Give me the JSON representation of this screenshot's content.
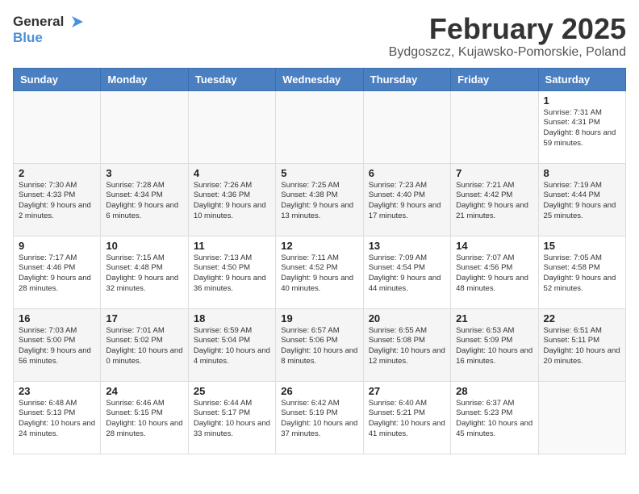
{
  "header": {
    "logo_general": "General",
    "logo_blue": "Blue",
    "title": "February 2025",
    "subtitle": "Bydgoszcz, Kujawsko-Pomorskie, Poland"
  },
  "columns": [
    "Sunday",
    "Monday",
    "Tuesday",
    "Wednesday",
    "Thursday",
    "Friday",
    "Saturday"
  ],
  "weeks": [
    [
      {
        "day": "",
        "text": ""
      },
      {
        "day": "",
        "text": ""
      },
      {
        "day": "",
        "text": ""
      },
      {
        "day": "",
        "text": ""
      },
      {
        "day": "",
        "text": ""
      },
      {
        "day": "",
        "text": ""
      },
      {
        "day": "1",
        "text": "Sunrise: 7:31 AM\nSunset: 4:31 PM\nDaylight: 8 hours and 59 minutes."
      }
    ],
    [
      {
        "day": "2",
        "text": "Sunrise: 7:30 AM\nSunset: 4:33 PM\nDaylight: 9 hours and 2 minutes."
      },
      {
        "day": "3",
        "text": "Sunrise: 7:28 AM\nSunset: 4:34 PM\nDaylight: 9 hours and 6 minutes."
      },
      {
        "day": "4",
        "text": "Sunrise: 7:26 AM\nSunset: 4:36 PM\nDaylight: 9 hours and 10 minutes."
      },
      {
        "day": "5",
        "text": "Sunrise: 7:25 AM\nSunset: 4:38 PM\nDaylight: 9 hours and 13 minutes."
      },
      {
        "day": "6",
        "text": "Sunrise: 7:23 AM\nSunset: 4:40 PM\nDaylight: 9 hours and 17 minutes."
      },
      {
        "day": "7",
        "text": "Sunrise: 7:21 AM\nSunset: 4:42 PM\nDaylight: 9 hours and 21 minutes."
      },
      {
        "day": "8",
        "text": "Sunrise: 7:19 AM\nSunset: 4:44 PM\nDaylight: 9 hours and 25 minutes."
      }
    ],
    [
      {
        "day": "9",
        "text": "Sunrise: 7:17 AM\nSunset: 4:46 PM\nDaylight: 9 hours and 28 minutes."
      },
      {
        "day": "10",
        "text": "Sunrise: 7:15 AM\nSunset: 4:48 PM\nDaylight: 9 hours and 32 minutes."
      },
      {
        "day": "11",
        "text": "Sunrise: 7:13 AM\nSunset: 4:50 PM\nDaylight: 9 hours and 36 minutes."
      },
      {
        "day": "12",
        "text": "Sunrise: 7:11 AM\nSunset: 4:52 PM\nDaylight: 9 hours and 40 minutes."
      },
      {
        "day": "13",
        "text": "Sunrise: 7:09 AM\nSunset: 4:54 PM\nDaylight: 9 hours and 44 minutes."
      },
      {
        "day": "14",
        "text": "Sunrise: 7:07 AM\nSunset: 4:56 PM\nDaylight: 9 hours and 48 minutes."
      },
      {
        "day": "15",
        "text": "Sunrise: 7:05 AM\nSunset: 4:58 PM\nDaylight: 9 hours and 52 minutes."
      }
    ],
    [
      {
        "day": "16",
        "text": "Sunrise: 7:03 AM\nSunset: 5:00 PM\nDaylight: 9 hours and 56 minutes."
      },
      {
        "day": "17",
        "text": "Sunrise: 7:01 AM\nSunset: 5:02 PM\nDaylight: 10 hours and 0 minutes."
      },
      {
        "day": "18",
        "text": "Sunrise: 6:59 AM\nSunset: 5:04 PM\nDaylight: 10 hours and 4 minutes."
      },
      {
        "day": "19",
        "text": "Sunrise: 6:57 AM\nSunset: 5:06 PM\nDaylight: 10 hours and 8 minutes."
      },
      {
        "day": "20",
        "text": "Sunrise: 6:55 AM\nSunset: 5:08 PM\nDaylight: 10 hours and 12 minutes."
      },
      {
        "day": "21",
        "text": "Sunrise: 6:53 AM\nSunset: 5:09 PM\nDaylight: 10 hours and 16 minutes."
      },
      {
        "day": "22",
        "text": "Sunrise: 6:51 AM\nSunset: 5:11 PM\nDaylight: 10 hours and 20 minutes."
      }
    ],
    [
      {
        "day": "23",
        "text": "Sunrise: 6:48 AM\nSunset: 5:13 PM\nDaylight: 10 hours and 24 minutes."
      },
      {
        "day": "24",
        "text": "Sunrise: 6:46 AM\nSunset: 5:15 PM\nDaylight: 10 hours and 28 minutes."
      },
      {
        "day": "25",
        "text": "Sunrise: 6:44 AM\nSunset: 5:17 PM\nDaylight: 10 hours and 33 minutes."
      },
      {
        "day": "26",
        "text": "Sunrise: 6:42 AM\nSunset: 5:19 PM\nDaylight: 10 hours and 37 minutes."
      },
      {
        "day": "27",
        "text": "Sunrise: 6:40 AM\nSunset: 5:21 PM\nDaylight: 10 hours and 41 minutes."
      },
      {
        "day": "28",
        "text": "Sunrise: 6:37 AM\nSunset: 5:23 PM\nDaylight: 10 hours and 45 minutes."
      },
      {
        "day": "",
        "text": ""
      }
    ]
  ]
}
